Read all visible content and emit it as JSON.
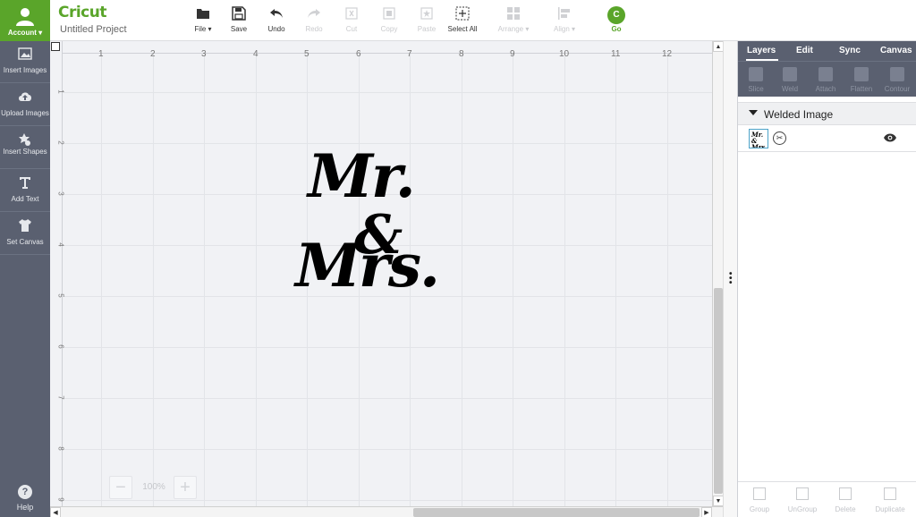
{
  "account": {
    "label": "Account"
  },
  "sidebar": {
    "items": [
      {
        "label": "Insert Images",
        "icon": "image-icon"
      },
      {
        "label": "Upload Images",
        "icon": "cloud-upload-icon"
      },
      {
        "label": "Insert Shapes",
        "icon": "shapes-icon"
      },
      {
        "label": "Add Text",
        "icon": "text-icon"
      },
      {
        "label": "Set Canvas",
        "icon": "tshirt-icon"
      }
    ],
    "help": {
      "label": "Help",
      "glyph": "?"
    }
  },
  "header": {
    "logo": "Cricut",
    "project_name": "Untitled Project",
    "tools": [
      {
        "label": "File ▾",
        "icon": "folder-icon",
        "enabled": true
      },
      {
        "label": "Save",
        "icon": "save-icon",
        "enabled": true
      },
      {
        "label": "Undo",
        "icon": "undo-icon",
        "enabled": true
      },
      {
        "label": "Redo",
        "icon": "redo-icon",
        "enabled": false
      },
      {
        "label": "Cut",
        "icon": "cut-icon",
        "enabled": false
      },
      {
        "label": "Copy",
        "icon": "copy-icon",
        "enabled": false
      },
      {
        "label": "Paste",
        "icon": "paste-icon",
        "enabled": false
      },
      {
        "label": "Select All",
        "icon": "select-all-icon",
        "enabled": true
      },
      {
        "label": "Arrange ▾",
        "icon": "arrange-icon",
        "enabled": false
      },
      {
        "label": "Align ▾",
        "icon": "align-icon",
        "enabled": false
      }
    ],
    "go": {
      "label": "Go",
      "glyph": "C"
    }
  },
  "canvas": {
    "ruler_top": [
      "1",
      "2",
      "3",
      "4",
      "5",
      "6",
      "7",
      "8",
      "9",
      "10",
      "11",
      "12"
    ],
    "ruler_left": [
      "1",
      "2",
      "3",
      "4",
      "5",
      "6",
      "7",
      "8",
      "9"
    ],
    "design": {
      "line1": "Mr.",
      "amp": "&",
      "line2": "Mrs."
    },
    "zoom": {
      "minus": "−",
      "plus": "+",
      "level": "100%"
    }
  },
  "panel": {
    "tabs": [
      "Layers",
      "Edit",
      "Sync",
      "Canvas"
    ],
    "tools": [
      "Slice",
      "Weld",
      "Attach",
      "Flatten",
      "Contour"
    ],
    "group_name": "Welded Image",
    "layer_thumb_text": "Mr. & Mrs.",
    "bottom_tools": [
      "Group",
      "UnGroup",
      "Delete",
      "Duplicate"
    ]
  },
  "colors": {
    "brand": "#5aa52a",
    "sidebar": "#5a6070",
    "canvas_bg": "#f1f2f5"
  }
}
